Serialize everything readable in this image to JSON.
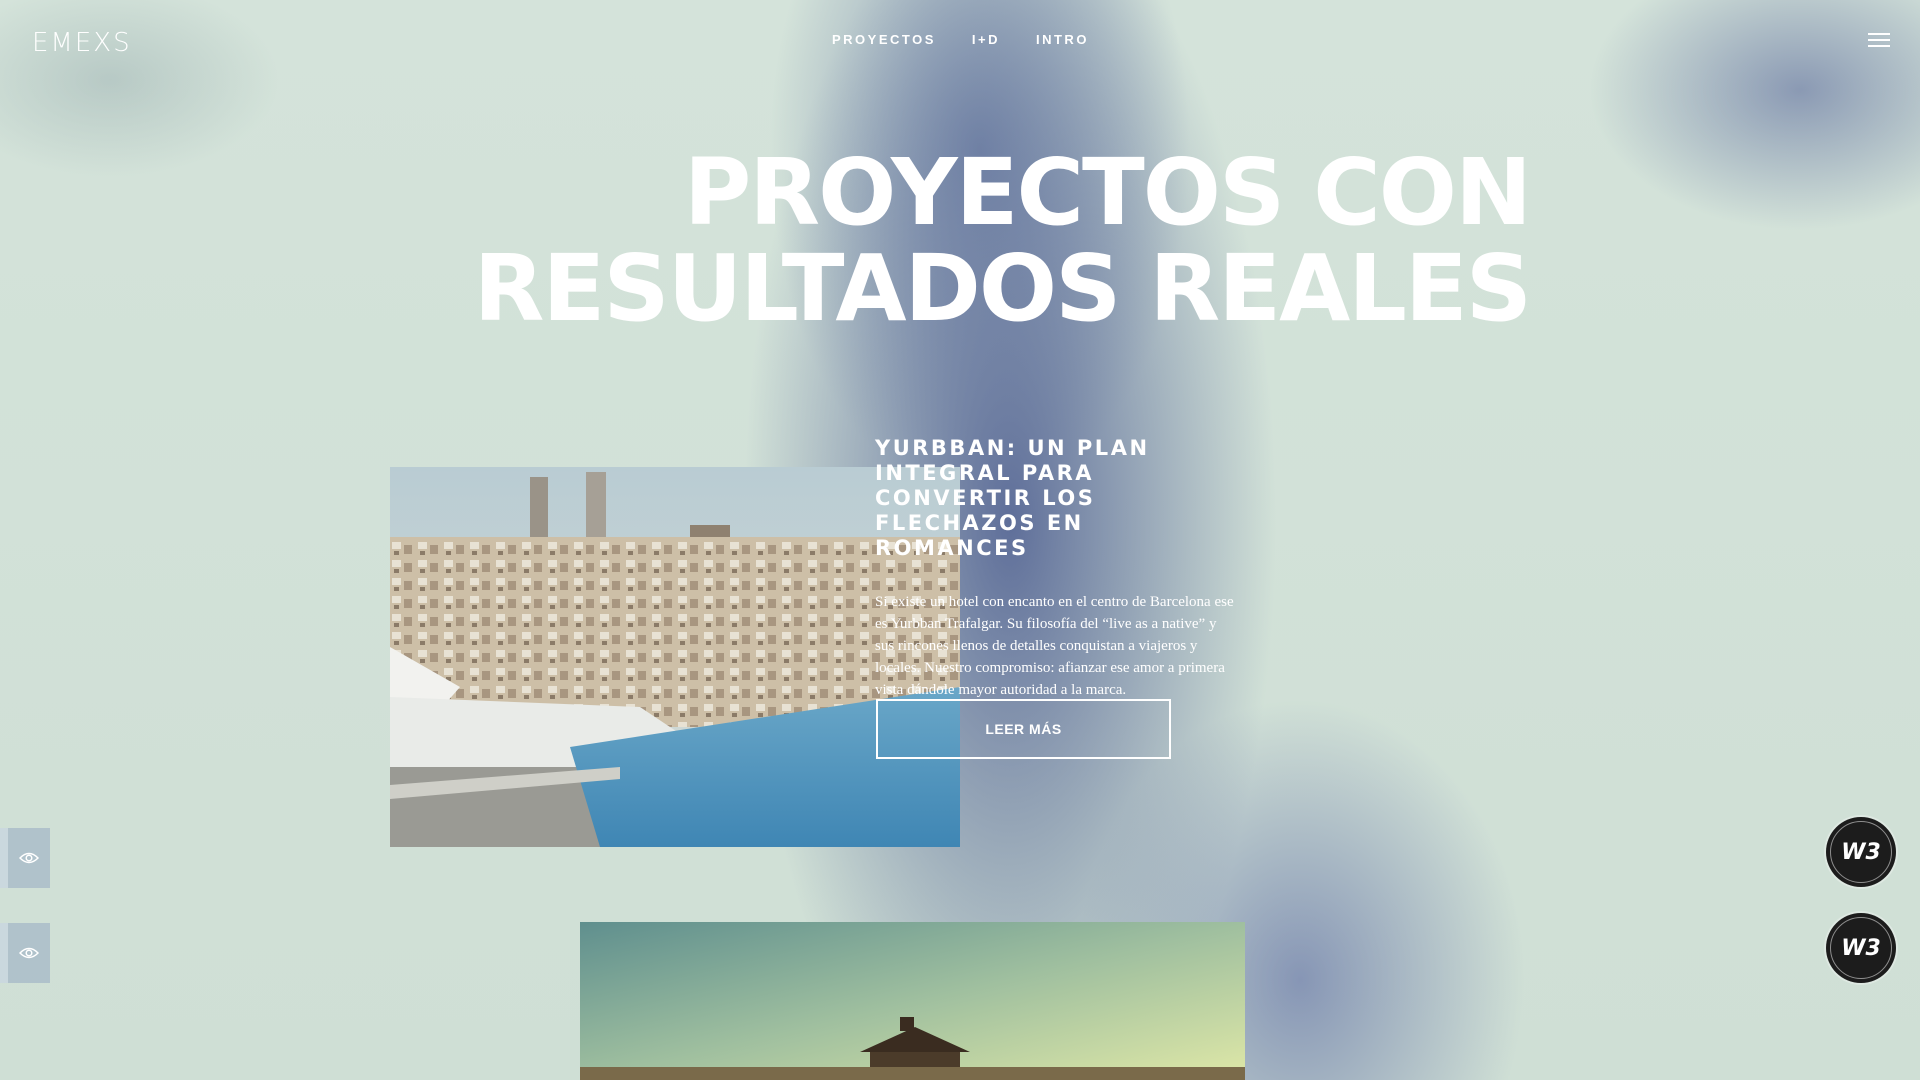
{
  "header": {
    "logo": "EMEXS",
    "nav": [
      "PROYECTOS",
      "I+D",
      "INTRO"
    ]
  },
  "hero": {
    "line1": "PROYECTOS CON",
    "line2": "RESULTADOS REALES"
  },
  "project1": {
    "title": "YURBBAN: UN PLAN INTEGRAL PARA CONVERTIR LOS FLECHAZOS EN ROMANCES",
    "description": "Si existe un hotel con encanto en el centro de Barcelona ese es Yurbban Trafalgar. Su filosofía del “live as a native” y sus rincones llenos de detalles conquistan a viajeros y locales. Nuestro compromiso: afianzar ese amor a primera vista dándole mayor autoridad a la marca.",
    "button": "LEER MÁS"
  },
  "badges": {
    "mark": "W3"
  },
  "icons": {
    "menu": "hamburger-icon",
    "side": "eye-icon"
  },
  "colors": {
    "background": "#d2e1d8",
    "accent_blue": "#586896",
    "text": "#ffffff"
  }
}
